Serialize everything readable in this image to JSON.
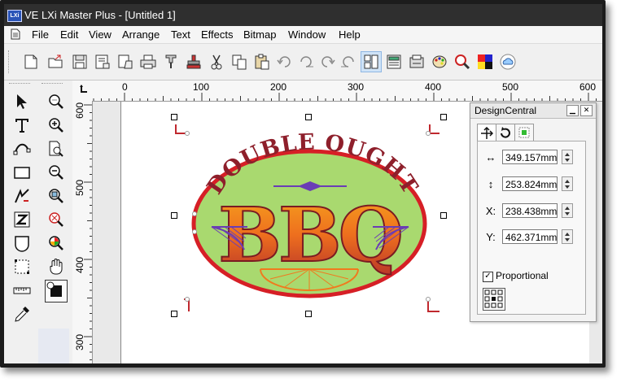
{
  "window": {
    "app_icon_text": "LXi",
    "title": "VE LXi Master Plus - [Untitled 1]"
  },
  "menu": {
    "items": [
      "File",
      "Edit",
      "View",
      "Arrange",
      "Text",
      "Effects",
      "Bitmap",
      "Window",
      "Help"
    ]
  },
  "toolbar": {
    "buttons": [
      "new-document-icon",
      "open-document-icon",
      "save-icon",
      "print-setup-icon",
      "print-preview-icon",
      "print-icon",
      "pen-tool-icon",
      "stamp-icon",
      "cut-icon",
      "copy-icon",
      "paste-icon",
      "undo-icon",
      "undo-list-icon",
      "redo-icon",
      "redo-list-icon",
      "properties-icon",
      "layers-icon",
      "output-icon",
      "palette-icon",
      "zoom-icon",
      "color-grid-icon",
      "cloud-icon"
    ]
  },
  "rulers": {
    "horizontal": [
      "0",
      "100",
      "200",
      "300",
      "400",
      "500",
      "600"
    ],
    "vertical": [
      "600",
      "500",
      "400",
      "300"
    ]
  },
  "design": {
    "top_text": "DOUBLE OUGHT",
    "main_text": "BBQ",
    "colors": {
      "ellipse_fill": "#a9d96f",
      "ellipse_stroke": "#d61f26",
      "text_maroon": "#8e1f2b",
      "bbq_orange": "#f07a1e",
      "ornament_purple": "#6a3db5",
      "handle_red": "#c0282e"
    }
  },
  "design_central": {
    "title": "DesignCentral",
    "width_value": "349.157mm",
    "height_value": "253.824mm",
    "x_label": "X:",
    "x_value": "238.438mm",
    "y_label": "Y:",
    "y_value": "462.371mm",
    "proportional_label": "Proportional",
    "proportional_checked": true,
    "width_icon": "↔",
    "height_icon": "↕"
  }
}
